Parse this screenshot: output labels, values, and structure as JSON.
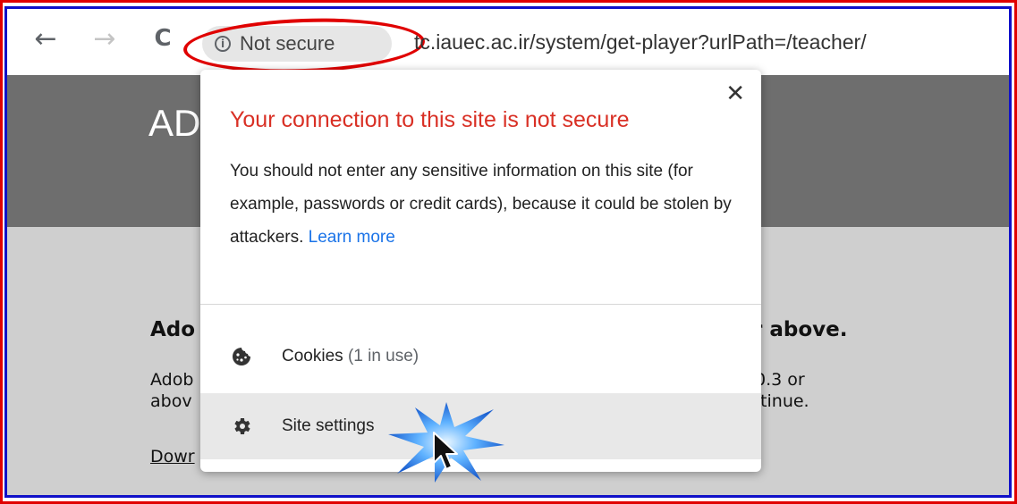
{
  "toolbar": {
    "back_glyph": "←",
    "forward_glyph": "→",
    "reload_glyph": "C",
    "security_chip_label": "Not secure",
    "info_glyph": "i",
    "url_visible_text": "tc.iauec.ac.ir/system/get-player?urlPath=/teacher/"
  },
  "page": {
    "title_fragment": "AD",
    "heading_fragment_left": "Ado",
    "heading_fragment_right": "r above.",
    "body_fragments_left": [
      "Adob",
      "abov"
    ],
    "body_fragments_right": [
      "0.3 or",
      "ntinue."
    ],
    "link_fragment": "Dowr"
  },
  "popup": {
    "close_glyph": "✕",
    "title": "Your connection to this site is not secure",
    "body": "You should not enter any sensitive information on this site (for example, passwords or credit cards), because it could be stolen by attackers.",
    "learn_more": "Learn more",
    "cookies_label": "Cookies",
    "cookies_count": "(1 in use)",
    "site_settings_label": "Site settings"
  },
  "colors": {
    "warning_title": "#d93025",
    "link": "#1a73e8",
    "annotation_red": "#e00000",
    "annotation_blue": "#1010c8",
    "starburst": "#3a8ee8"
  },
  "icons": [
    "back-arrow-icon",
    "forward-arrow-icon",
    "reload-icon",
    "info-icon",
    "close-icon",
    "cookie-icon",
    "gear-icon",
    "cursor-pointer-icon"
  ]
}
